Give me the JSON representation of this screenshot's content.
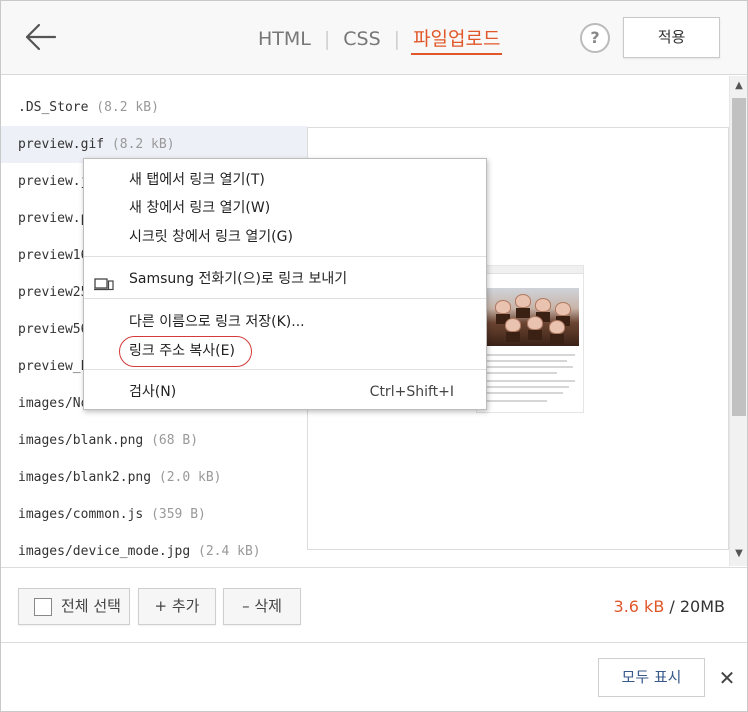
{
  "header": {
    "tabs": [
      {
        "label": "HTML",
        "active": false
      },
      {
        "label": "CSS",
        "active": false
      },
      {
        "label": "파일업로드",
        "active": true
      }
    ],
    "separator": "|",
    "help_label": "?",
    "apply_label": "적용"
  },
  "files": [
    {
      "name": ".DS_Store",
      "size": "(8.2 kB)"
    },
    {
      "name": "preview.gif",
      "size": "(8.2 kB)"
    },
    {
      "name": "preview.j",
      "size": ""
    },
    {
      "name": "preview.p",
      "size": ""
    },
    {
      "name": "preview16",
      "size": ""
    },
    {
      "name": "preview25",
      "size": ""
    },
    {
      "name": "preview56",
      "size": ""
    },
    {
      "name": "preview_b",
      "size": ""
    },
    {
      "name": "images/No",
      "size": ""
    },
    {
      "name": "images/blank.png",
      "size": "(68 B)"
    },
    {
      "name": "images/blank2.png",
      "size": "(2.0 kB)"
    },
    {
      "name": "images/common.js",
      "size": "(359 B)"
    },
    {
      "name": "images/device_mode.jpg",
      "size": "(2.4 kB)"
    }
  ],
  "context_menu": {
    "items": [
      {
        "label": "새 탭에서 링크 열기(T)"
      },
      {
        "label": "새 창에서 링크 열기(W)"
      },
      {
        "label": "시크릿 창에서 링크 열기(G)"
      },
      {
        "label": "Samsung 전화기(으)로 링크 보내기",
        "icon": "device-icon"
      },
      {
        "label": "다른 이름으로 링크 저장(K)..."
      },
      {
        "label": "링크 주소 복사(E)",
        "highlighted": true
      },
      {
        "label": "검사(N)",
        "shortcut": "Ctrl+Shift+I"
      }
    ]
  },
  "toolbar": {
    "select_all_label": "전체 선택",
    "add_label": "+ 추가",
    "delete_label": "– 삭제",
    "storage_used": "3.6 kB",
    "storage_total": " / 20MB"
  },
  "bottom": {
    "show_all_label": "모두 표시",
    "close_label": "✕"
  },
  "colors": {
    "accent": "#e0582a",
    "highlight_ring": "#d53a3a",
    "link_blue": "#3a5a8c"
  }
}
